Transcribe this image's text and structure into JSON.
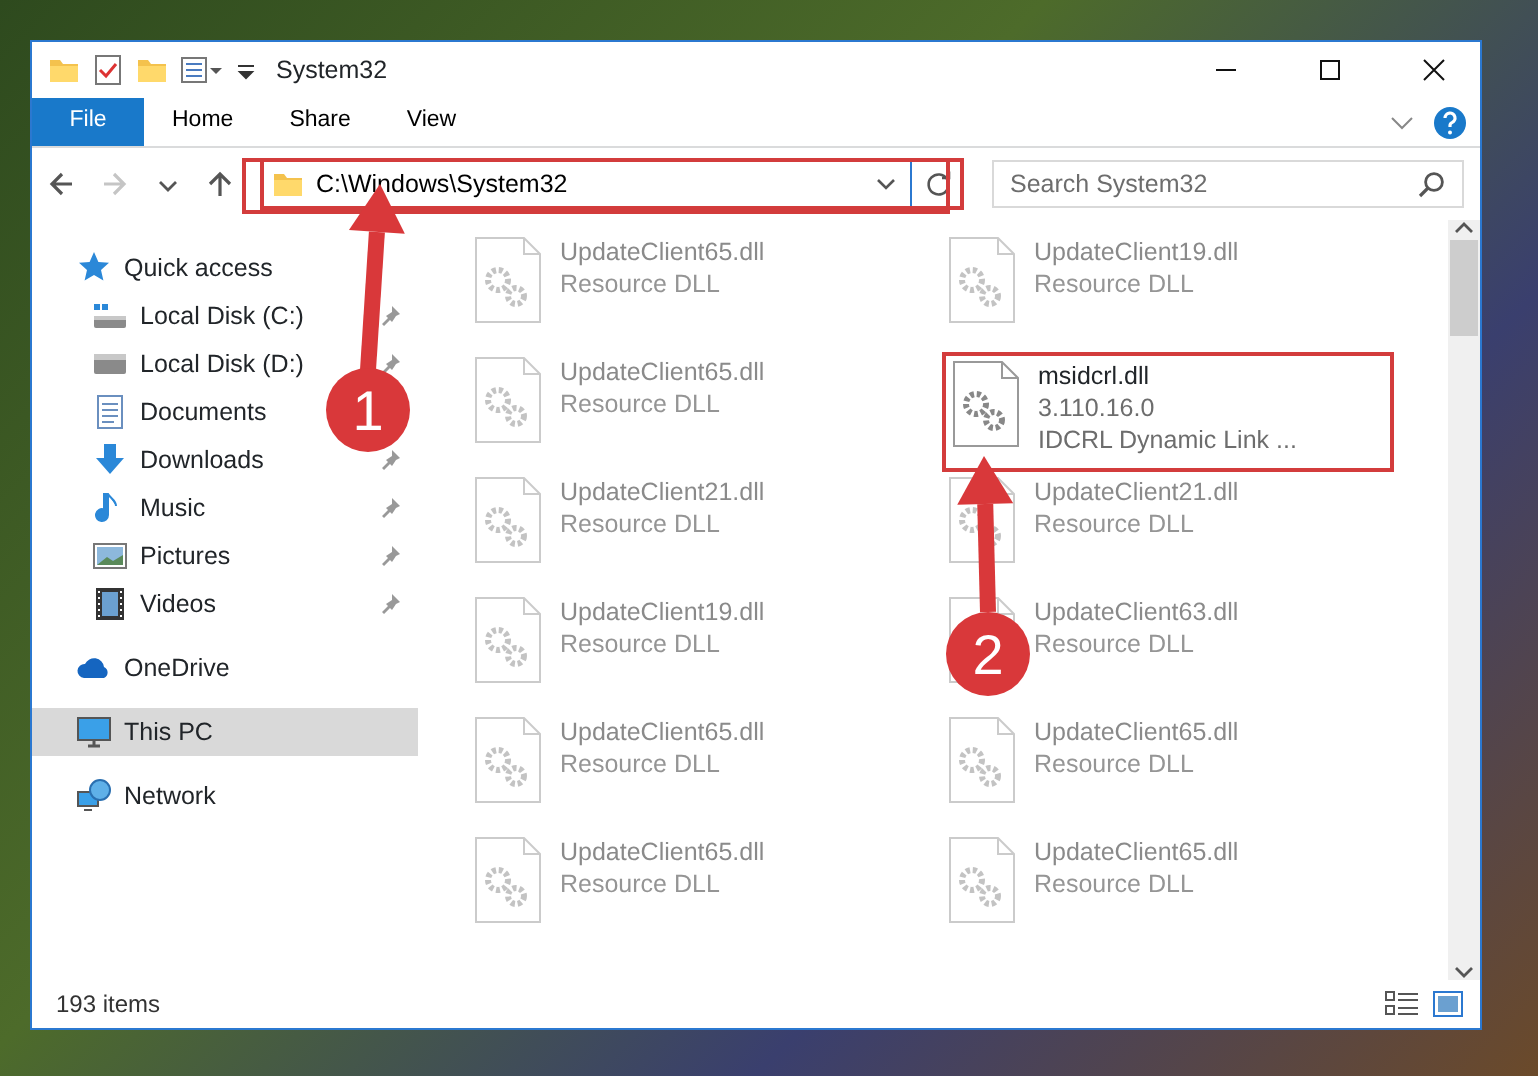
{
  "window": {
    "title": "System32"
  },
  "ribbon_tabs": [
    {
      "label": "File",
      "kind": "file",
      "selected": false
    },
    {
      "label": "Home",
      "kind": "tab",
      "selected": false
    },
    {
      "label": "Share",
      "kind": "tab",
      "selected": false
    },
    {
      "label": "View",
      "kind": "tab",
      "selected": false
    }
  ],
  "nav_buttons": [
    {
      "kind": "back",
      "disabled": false
    },
    {
      "kind": "forward",
      "disabled": true
    },
    {
      "kind": "recent",
      "disabled": false
    },
    {
      "kind": "up",
      "disabled": false
    }
  ],
  "address": {
    "path": "C:\\Windows\\System32"
  },
  "search": {
    "placeholder": "Search System32"
  },
  "sidebar": {
    "items": [
      {
        "label": "Quick access",
        "kind": "star",
        "selected": false,
        "pinned": false,
        "children": [
          {
            "label": "Local Disk (C:)",
            "kind": "system-drive",
            "selected": false,
            "pinned": true
          },
          {
            "label": "Local Disk (D:)",
            "kind": "drive",
            "selected": false,
            "pinned": true
          },
          {
            "label": "Documents",
            "kind": "documents",
            "selected": false,
            "pinned": false
          },
          {
            "label": "Downloads",
            "kind": "downloads",
            "selected": false,
            "pinned": true
          },
          {
            "label": "Music",
            "kind": "music",
            "selected": false,
            "pinned": true
          },
          {
            "label": "Pictures",
            "kind": "pictures",
            "selected": false,
            "pinned": true
          },
          {
            "label": "Videos",
            "kind": "videos",
            "selected": false,
            "pinned": true
          }
        ]
      },
      {
        "label": "OneDrive",
        "kind": "cloud",
        "selected": false,
        "pinned": false
      },
      {
        "label": "This PC",
        "kind": "computer",
        "selected": true,
        "pinned": false
      },
      {
        "label": "Network",
        "kind": "network",
        "selected": false,
        "pinned": false
      }
    ]
  },
  "files": [
    {
      "name": "UpdateClient65.dll",
      "details": [
        "Resource DLL"
      ],
      "dimmed": true,
      "highlighted": false
    },
    {
      "name": "UpdateClient19.dll",
      "details": [
        "Resource DLL"
      ],
      "dimmed": true,
      "highlighted": false
    },
    {
      "name": "UpdateClient65.dll",
      "details": [
        "Resource DLL"
      ],
      "dimmed": true,
      "highlighted": false
    },
    {
      "name": "msidcrl.dll",
      "details": [
        "3.110.16.0",
        "IDCRL Dynamic Link ..."
      ],
      "dimmed": false,
      "highlighted": true
    },
    {
      "name": "UpdateClient21.dll",
      "details": [
        "Resource DLL"
      ],
      "dimmed": true,
      "highlighted": false
    },
    {
      "name": "UpdateClient21.dll",
      "details": [
        "Resource DLL"
      ],
      "dimmed": true,
      "highlighted": false
    },
    {
      "name": "UpdateClient19.dll",
      "details": [
        "Resource DLL"
      ],
      "dimmed": true,
      "highlighted": false
    },
    {
      "name": "UpdateClient63.dll",
      "details": [
        "Resource DLL"
      ],
      "dimmed": true,
      "highlighted": false
    },
    {
      "name": "UpdateClient65.dll",
      "details": [
        "Resource DLL"
      ],
      "dimmed": true,
      "highlighted": false
    },
    {
      "name": "UpdateClient65.dll",
      "details": [
        "Resource DLL"
      ],
      "dimmed": true,
      "highlighted": false
    },
    {
      "name": "UpdateClient65.dll",
      "details": [
        "Resource DLL"
      ],
      "dimmed": true,
      "highlighted": false
    },
    {
      "name": "UpdateClient65.dll",
      "details": [
        "Resource DLL"
      ],
      "dimmed": true,
      "highlighted": false
    }
  ],
  "status_bar": {
    "item_count": "193 items"
  },
  "annotations": [
    {
      "label": "1"
    },
    {
      "label": "2"
    }
  ]
}
